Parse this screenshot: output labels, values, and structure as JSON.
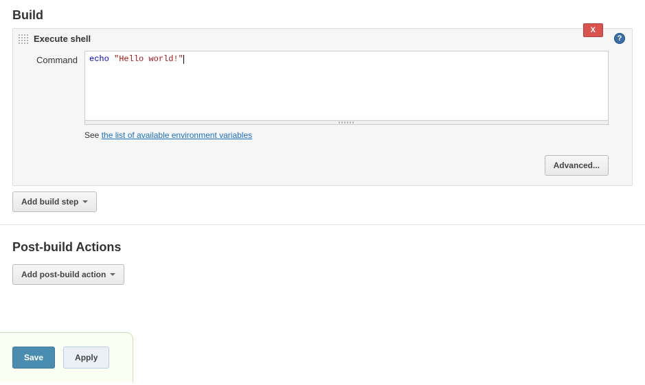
{
  "build": {
    "title": "Build",
    "step": {
      "type_label": "Execute shell",
      "delete_label": "X",
      "help_label": "?",
      "command_label": "Command",
      "command_value": {
        "keyword": "echo",
        "string": "\"Hello world!\""
      },
      "hint_prefix": "See ",
      "hint_link": "the list of available environment variables",
      "advanced_label": "Advanced..."
    },
    "add_step_label": "Add build step"
  },
  "postbuild": {
    "title": "Post-build Actions",
    "add_action_label": "Add post-build action"
  },
  "footer": {
    "save_label": "Save",
    "apply_label": "Apply"
  }
}
